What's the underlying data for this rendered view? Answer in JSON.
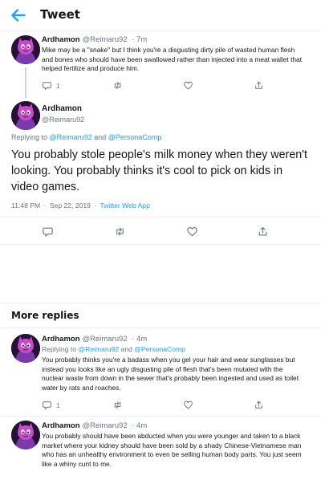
{
  "header": {
    "title": "Tweet"
  },
  "colors": {
    "accent": "#1da1f2",
    "muted": "#657786",
    "border": "#e6ecf0"
  },
  "parent_tweet": {
    "name": "Ardhamon",
    "handle": "@Reimaru92",
    "time": "· 7m",
    "text": "Mike may be a \"snake\" but I think you're a disgusting dirty pile of wasted human flesh and bones who should have been swallowed rather than injected into a meat wallet that helped fertilize and produce him.",
    "reply_count": "1"
  },
  "main_tweet": {
    "name": "Ardhamon",
    "handle": "@Reimaru92",
    "replying_prefix": "Replying to",
    "mention1": "@Reimaru92",
    "and": "and",
    "mention2": "@PersonaComp",
    "text": "You probably stole people's milk money when they weren't looking. You probably thinks it's cool to pick on kids in video games.",
    "time": "11:48 PM",
    "date": "Sep 22, 2019",
    "source": "Twitter Web App",
    "separator": "·"
  },
  "more_replies": {
    "title": "More replies",
    "items": [
      {
        "name": "Ardhamon",
        "handle": "@Reimaru92",
        "time": "· 4m",
        "replying_prefix": "Replying to",
        "mention1": "@Reimaru92",
        "and": "and",
        "mention2": "@PersonaComp",
        "text": "You probably thinks you're a badass when you gel your hair and wear sunglasses but instead you looks like an ugly disgusting pile of flesh that's been mutated with the nuclear waste from down in the sewer that's probably been ingested and used as toilet water by rats and roaches.",
        "reply_count": "1"
      },
      {
        "name": "Ardhamon",
        "handle": "@Reimaru92",
        "time": "· 4m",
        "text": "You probably should have been abducted when you were younger and taken to a black market where your kidney should have been sold by a shady Chinese-Vietnamese man who has an unhealthy environment to even be selling human body parts. You just seem like a whiny cunt to me."
      }
    ]
  },
  "icons": [
    "back-arrow-icon",
    "reply-icon",
    "retweet-icon",
    "like-icon",
    "share-icon"
  ]
}
